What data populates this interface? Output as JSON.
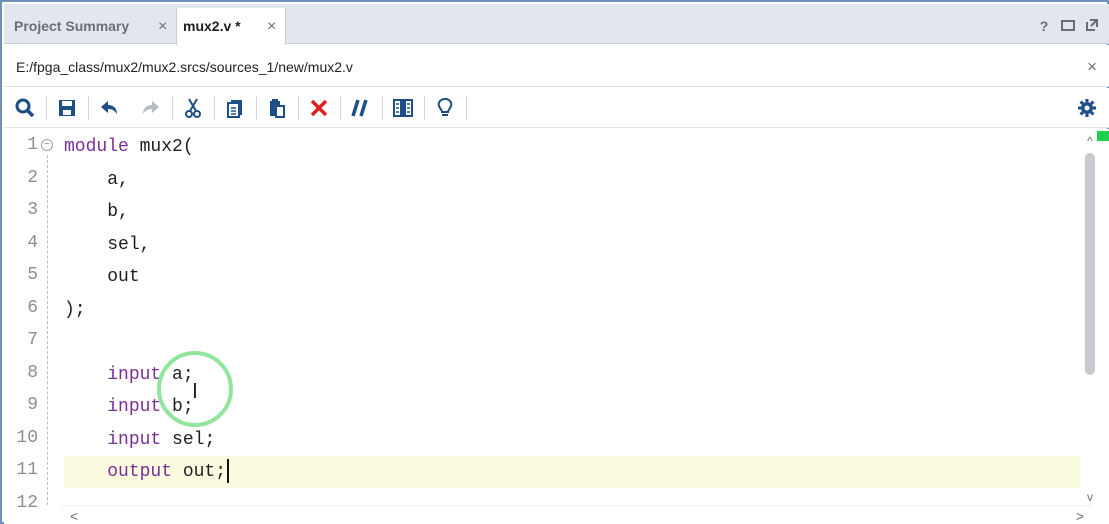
{
  "tabs": [
    {
      "label": "Project Summary",
      "close": "×"
    },
    {
      "label": "mux2.v *",
      "close": "×"
    }
  ],
  "window_controls": {
    "help": "?"
  },
  "path": {
    "value": "E:/fpga_class/mux2/mux2.srcs/sources_1/new/mux2.v",
    "close": "×"
  },
  "toolbar": {
    "icons": [
      "search-icon",
      "save-icon",
      "undo-icon",
      "redo-icon",
      "cut-icon",
      "copy-icon",
      "paste-icon",
      "delete-icon",
      "comment-icon",
      "columns-icon",
      "lightbulb-icon",
      "gear-icon"
    ]
  },
  "editor": {
    "lines": [
      {
        "num": "1",
        "indent": "",
        "kw": "module",
        "rest": " mux2("
      },
      {
        "num": "2",
        "indent": "    ",
        "kw": "",
        "rest": "a,"
      },
      {
        "num": "3",
        "indent": "    ",
        "kw": "",
        "rest": "b,"
      },
      {
        "num": "4",
        "indent": "    ",
        "kw": "",
        "rest": "sel,"
      },
      {
        "num": "5",
        "indent": "    ",
        "kw": "",
        "rest": "out"
      },
      {
        "num": "6",
        "indent": "",
        "kw": "",
        "rest": ");"
      },
      {
        "num": "7",
        "indent": "",
        "kw": "",
        "rest": ""
      },
      {
        "num": "8",
        "indent": "    ",
        "kw": "input",
        "rest": " a;"
      },
      {
        "num": "9",
        "indent": "    ",
        "kw": "input",
        "rest": " b;"
      },
      {
        "num": "10",
        "indent": "    ",
        "kw": "input",
        "rest": " sel;"
      },
      {
        "num": "11",
        "indent": "    ",
        "kw": "output",
        "rest": " out;"
      },
      {
        "num": "12",
        "indent": "",
        "kw": "",
        "rest": ""
      }
    ],
    "current_line": "11"
  },
  "colors": {
    "keyword": "#7a2f95",
    "current_line": "#fbfbe0",
    "click_ring": "#7fe08b",
    "delete": "#e02020",
    "toolbar_blue": "#1d4f86"
  }
}
